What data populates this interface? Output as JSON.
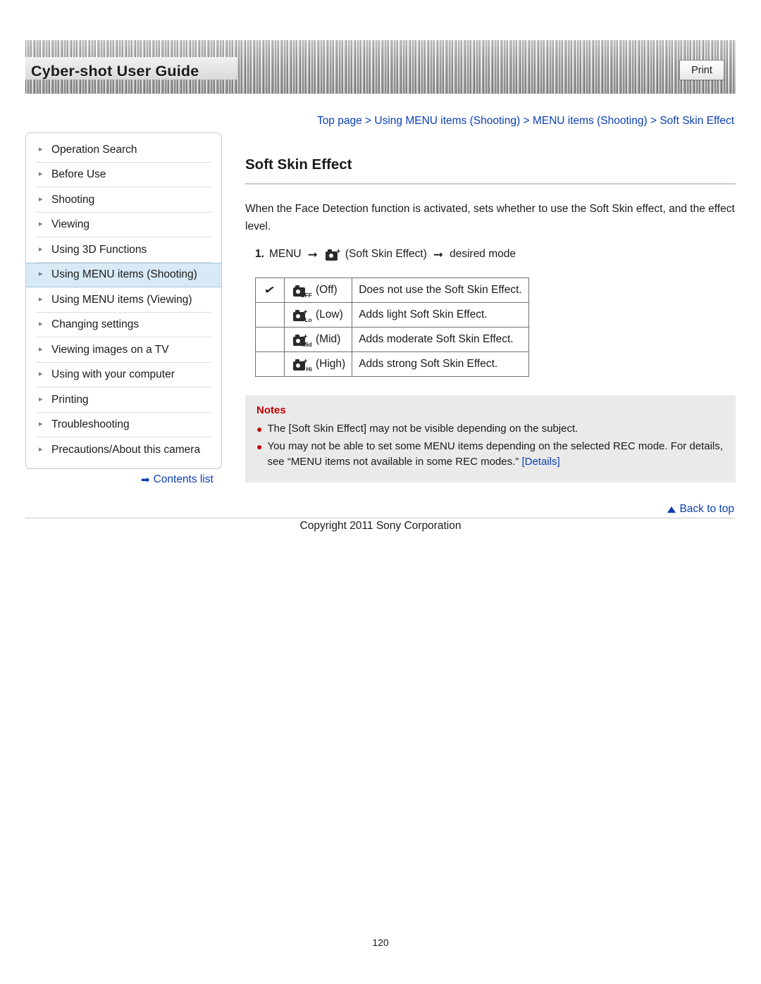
{
  "header": {
    "title": "Cyber-shot User Guide",
    "print_label": "Print"
  },
  "breadcrumb": {
    "items": [
      "Top page",
      "Using MENU items (Shooting)",
      "MENU items (Shooting)",
      "Soft Skin Effect"
    ],
    "separator": ">"
  },
  "sidebar": {
    "items": [
      {
        "label": "Operation Search"
      },
      {
        "label": "Before Use"
      },
      {
        "label": "Shooting"
      },
      {
        "label": "Viewing"
      },
      {
        "label": "Using 3D Functions"
      },
      {
        "label": "Using MENU items (Shooting)"
      },
      {
        "label": "Using MENU items (Viewing)"
      },
      {
        "label": "Changing settings"
      },
      {
        "label": "Viewing images on a TV"
      },
      {
        "label": "Using with your computer"
      },
      {
        "label": "Printing"
      },
      {
        "label": "Troubleshooting"
      },
      {
        "label": "Precautions/About this camera"
      }
    ],
    "contents_link": "Contents list"
  },
  "main": {
    "title": "Soft Skin Effect",
    "intro": "When the Face Detection function is activated, sets whether to use the Soft Skin effect, and the effect level.",
    "step": {
      "number": "1.",
      "menu_label": "MENU",
      "icon_label": "(Soft Skin Effect)",
      "end_label": "desired mode"
    },
    "options_table": {
      "rows": [
        {
          "checked": true,
          "icon_sub": "OFF",
          "icon_label": "(Off)",
          "description": "Does not use the Soft Skin Effect."
        },
        {
          "checked": false,
          "icon_sub": "Lo",
          "icon_label": "(Low)",
          "description": "Adds light Soft Skin Effect."
        },
        {
          "checked": false,
          "icon_sub": "Mid",
          "icon_label": "(Mid)",
          "description": "Adds moderate Soft Skin Effect."
        },
        {
          "checked": false,
          "icon_sub": "Hi",
          "icon_label": "(High)",
          "description": "Adds strong Soft Skin Effect."
        }
      ]
    },
    "notes": {
      "title": "Notes",
      "items": [
        {
          "text": "The [Soft Skin Effect] may not be visible depending on the subject.",
          "link": ""
        },
        {
          "text": "You may not be able to set some MENU items depending on the selected REC mode. For details, see “MENU items not available in some REC modes.” ",
          "link": "[Details]"
        }
      ]
    }
  },
  "footer": {
    "back_to_top": "Back to top",
    "copyright": "Copyright 2011 Sony Corporation",
    "page_number": "120"
  }
}
